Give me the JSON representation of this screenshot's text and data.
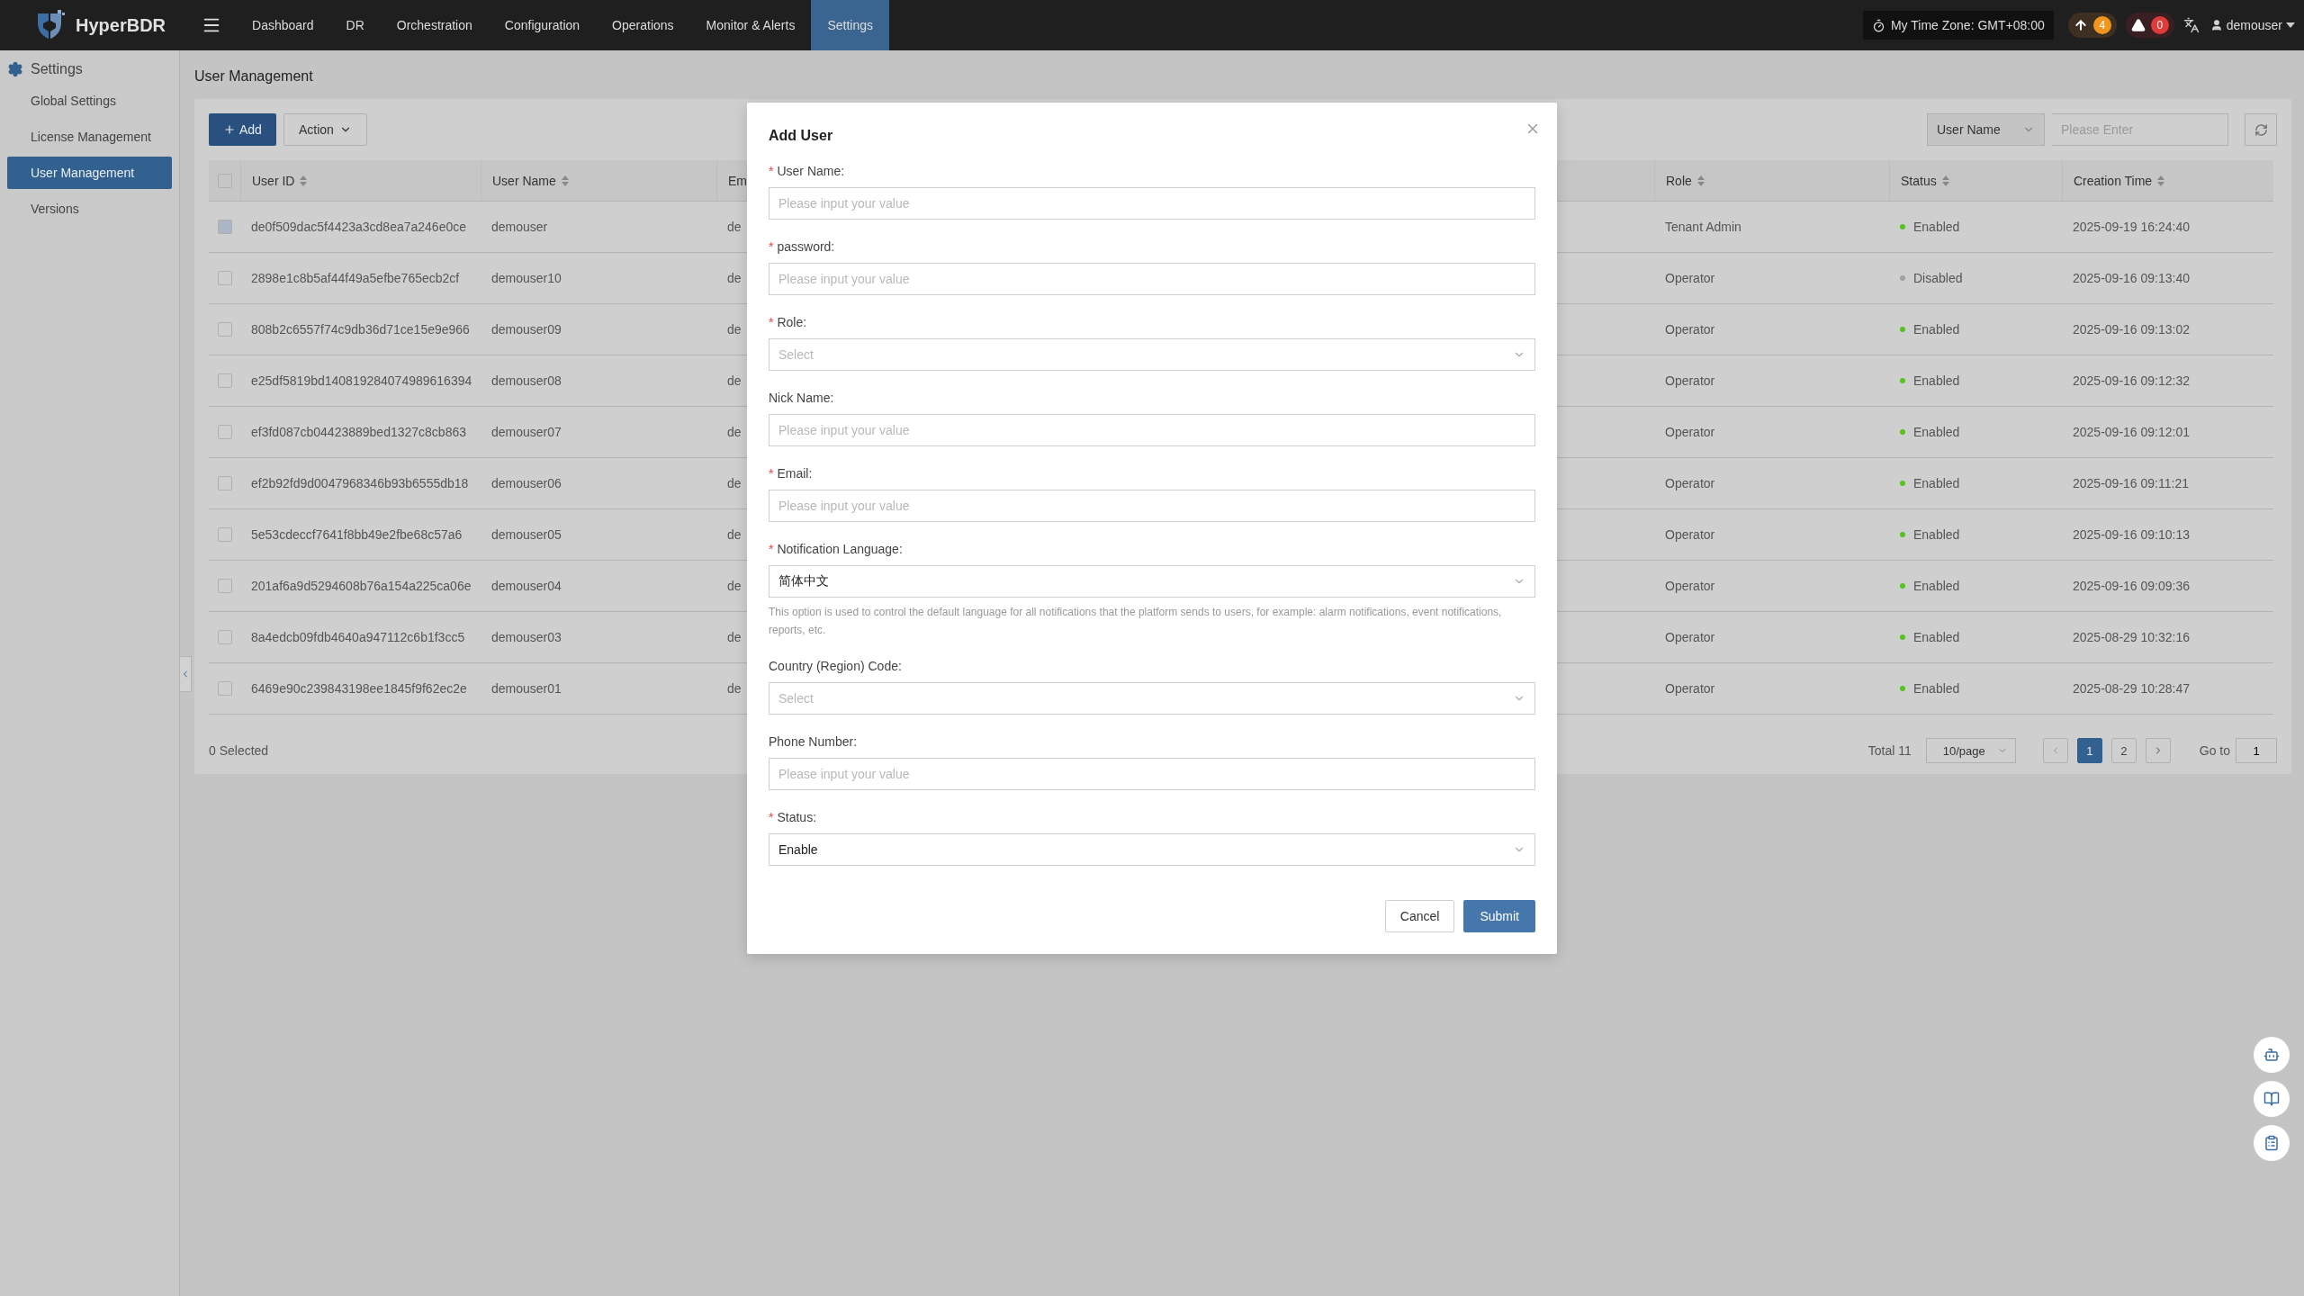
{
  "header": {
    "brand": "HyperBDR",
    "nav": [
      {
        "label": "Dashboard",
        "selected": false
      },
      {
        "label": "DR",
        "selected": false
      },
      {
        "label": "Orchestration",
        "selected": false
      },
      {
        "label": "Configuration",
        "selected": false
      },
      {
        "label": "Operations",
        "selected": false
      },
      {
        "label": "Monitor & Alerts",
        "selected": false
      },
      {
        "label": "Settings",
        "selected": true
      }
    ],
    "time_zone": "My Time Zone: GMT+08:00",
    "upload_count": "4",
    "alert_count": "0",
    "user": "demouser"
  },
  "sidebar": {
    "title": "Settings",
    "items": [
      {
        "label": "Global Settings",
        "selected": false
      },
      {
        "label": "License Management",
        "selected": false
      },
      {
        "label": "User Management",
        "selected": true
      },
      {
        "label": "Versions",
        "selected": false
      }
    ]
  },
  "page_title": "User Management",
  "toolbar": {
    "add": "Add",
    "action": "Action",
    "filter_field": "User Name",
    "search_placeholder": "Please Enter"
  },
  "table": {
    "select_all": {
      "checked": false
    },
    "columns": [
      "User ID",
      "User Name",
      "Em",
      "Role",
      "Status",
      "Creation Time"
    ],
    "rows": [
      {
        "checked": false,
        "disabled": true,
        "user_id": "de0f509dac5f4423a3cd8ea7a246e0ce",
        "user_name": "demouser",
        "email": "de",
        "role": "Tenant Admin",
        "status": "Enabled",
        "color": "#52c41a",
        "created": "2025-09-19 16:24:40"
      },
      {
        "checked": false,
        "disabled": false,
        "user_id": "2898e1c8b5af44f49a5efbe765ecb2cf",
        "user_name": "demouser10",
        "email": "de",
        "role": "Operator",
        "status": "Disabled",
        "color": "#a0a0a0",
        "created": "2025-09-16 09:13:40"
      },
      {
        "checked": false,
        "disabled": false,
        "user_id": "808b2c6557f74c9db36d71ce15e9e966",
        "user_name": "demouser09",
        "email": "de",
        "role": "Operator",
        "status": "Enabled",
        "color": "#52c41a",
        "created": "2025-09-16 09:13:02"
      },
      {
        "checked": false,
        "disabled": false,
        "user_id": "e25df5819bd140819284074989616394",
        "user_name": "demouser08",
        "email": "de",
        "role": "Operator",
        "status": "Enabled",
        "color": "#52c41a",
        "created": "2025-09-16 09:12:32"
      },
      {
        "checked": false,
        "disabled": false,
        "user_id": "ef3fd087cb04423889bed1327c8cb863",
        "user_name": "demouser07",
        "email": "de",
        "role": "Operator",
        "status": "Enabled",
        "color": "#52c41a",
        "created": "2025-09-16 09:12:01"
      },
      {
        "checked": false,
        "disabled": false,
        "user_id": "ef2b92fd9d0047968346b93b6555db18",
        "user_name": "demouser06",
        "email": "de",
        "role": "Operator",
        "status": "Enabled",
        "color": "#52c41a",
        "created": "2025-09-16 09:11:21"
      },
      {
        "checked": false,
        "disabled": false,
        "user_id": "5e53cdeccf7641f8bb49e2fbe68c57a6",
        "user_name": "demouser05",
        "email": "de",
        "role": "Operator",
        "status": "Enabled",
        "color": "#52c41a",
        "created": "2025-09-16 09:10:13"
      },
      {
        "checked": false,
        "disabled": false,
        "user_id": "201af6a9d5294608b76a154a225ca06e",
        "user_name": "demouser04",
        "email": "de",
        "role": "Operator",
        "status": "Enabled",
        "color": "#52c41a",
        "created": "2025-09-16 09:09:36"
      },
      {
        "checked": false,
        "disabled": false,
        "user_id": "8a4edcb09fdb4640a947112c6b1f3cc5",
        "user_name": "demouser03",
        "email": "de",
        "role": "Operator",
        "status": "Enabled",
        "color": "#52c41a",
        "created": "2025-08-29 10:32:16"
      },
      {
        "checked": false,
        "disabled": false,
        "user_id": "6469e90c239843198ee1845f9f62ec2e",
        "user_name": "demouser01",
        "email": "de",
        "role": "Operator",
        "status": "Enabled",
        "color": "#52c41a",
        "created": "2025-08-29 10:28:47"
      }
    ],
    "selected_count": "0 Selected"
  },
  "pagination": {
    "total": "Total 11",
    "page_size": "10/page",
    "pages": [
      {
        "label": "1",
        "selected": true
      },
      {
        "label": "2",
        "selected": false
      }
    ],
    "goto_label": "Go to",
    "goto_value": "1"
  },
  "modal": {
    "title": "Add User",
    "fields": [
      {
        "kind": "input",
        "required": "*",
        "label": "User Name:",
        "placeholder": "Please input your value"
      },
      {
        "kind": "input",
        "required": "*",
        "label": "password:",
        "placeholder": "Please input your value"
      },
      {
        "kind": "select",
        "required": "*",
        "label": "Role:",
        "placeholder": "Select"
      },
      {
        "kind": "input",
        "label": "Nick Name:",
        "placeholder": "Please input your value"
      },
      {
        "kind": "input",
        "required": "*",
        "label": "Email:",
        "placeholder": "Please input your value"
      },
      {
        "kind": "select",
        "required": "*",
        "label": "Notification Language:",
        "value": "简体中文",
        "hint": "This option is used to control the default language for all notifications that the platform sends to users, for example: alarm notifications, event notifications, reports, etc."
      },
      {
        "kind": "select",
        "label": "Country (Region) Code:",
        "placeholder": "Select"
      },
      {
        "kind": "input",
        "label": "Phone Number:",
        "placeholder": "Please input your value"
      },
      {
        "kind": "select",
        "required": "*",
        "label": "Status:",
        "value": "Enable"
      }
    ],
    "cancel": "Cancel",
    "submit": "Submit"
  }
}
